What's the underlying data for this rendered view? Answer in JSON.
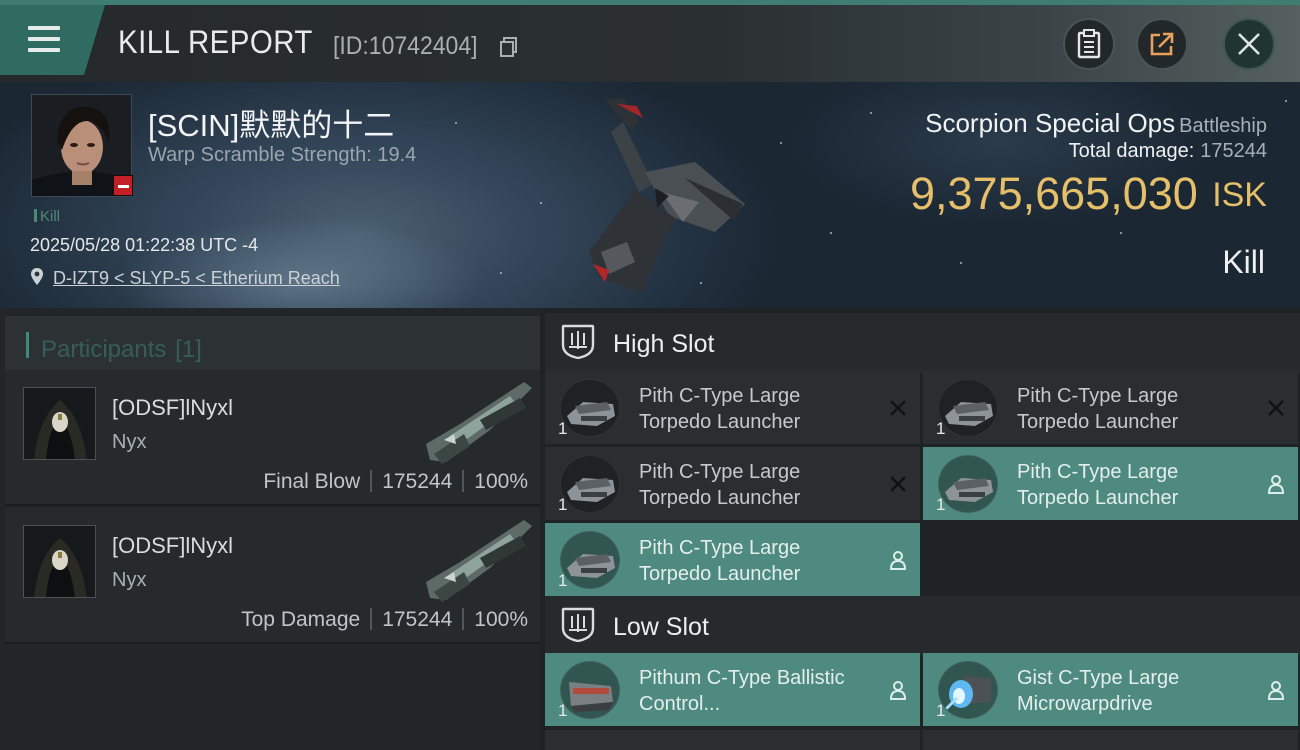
{
  "header": {
    "title": "KILL REPORT",
    "report_id": "[ID:10742404]"
  },
  "victim": {
    "name": "[SCIN]默默的十二",
    "warp_scramble": "Warp Scramble Strength: 19.4",
    "tag": "Kill",
    "datetime": "2025/05/28 01:22:38 UTC -4",
    "location": "D-IZT9 < SLYP-5 < Etherium Reach"
  },
  "ship": {
    "name": "Scorpion Special Ops",
    "class": "Battleship",
    "total_damage_label": "Total damage:",
    "total_damage": "175244",
    "isk_value": "9,375,665,030",
    "isk_unit": "ISK",
    "result": "Kill"
  },
  "participants": {
    "label": "Participants",
    "count": "[1]",
    "items": [
      {
        "name": "[ODSF]lNyxl",
        "ship": "Nyx",
        "role": "Final Blow",
        "damage": "175244",
        "percent": "100%"
      },
      {
        "name": "[ODSF]lNyxl",
        "ship": "Nyx",
        "role": "Top Damage",
        "damage": "175244",
        "percent": "100%"
      }
    ]
  },
  "slots": {
    "high": {
      "title": "High Slot",
      "modules": [
        {
          "qty": "1",
          "name": "Pith C-Type Large Torpedo Launcher",
          "state": "destroyed"
        },
        {
          "qty": "1",
          "name": "Pith C-Type Large Torpedo Launcher",
          "state": "destroyed"
        },
        {
          "qty": "1",
          "name": "Pith C-Type Large Torpedo Launcher",
          "state": "destroyed"
        },
        {
          "qty": "1",
          "name": "Pith C-Type Large Torpedo Launcher",
          "state": "dropped"
        },
        {
          "qty": "1",
          "name": "Pith C-Type Large Torpedo Launcher",
          "state": "dropped"
        }
      ]
    },
    "low": {
      "title": "Low Slot",
      "modules": [
        {
          "qty": "1",
          "name": "Pithum C-Type Ballistic Control...",
          "state": "dropped"
        },
        {
          "qty": "1",
          "name": "Gist C-Type Large Microwarpdrive",
          "state": "dropped"
        }
      ]
    }
  },
  "colors": {
    "accent": "#4e8a7f",
    "isk": "#e5bf69",
    "header_accent": "#2f6b61",
    "destroyed_badge": "#c21f26"
  },
  "icons": {
    "menu": "menu-icon",
    "copy": "copy-icon",
    "clipboard": "clipboard-icon",
    "share": "share-icon",
    "close": "close-icon",
    "location": "map-pin-icon",
    "slot": "shield-slot-icon",
    "destroyed": "x-icon",
    "dropped": "person-icon"
  }
}
